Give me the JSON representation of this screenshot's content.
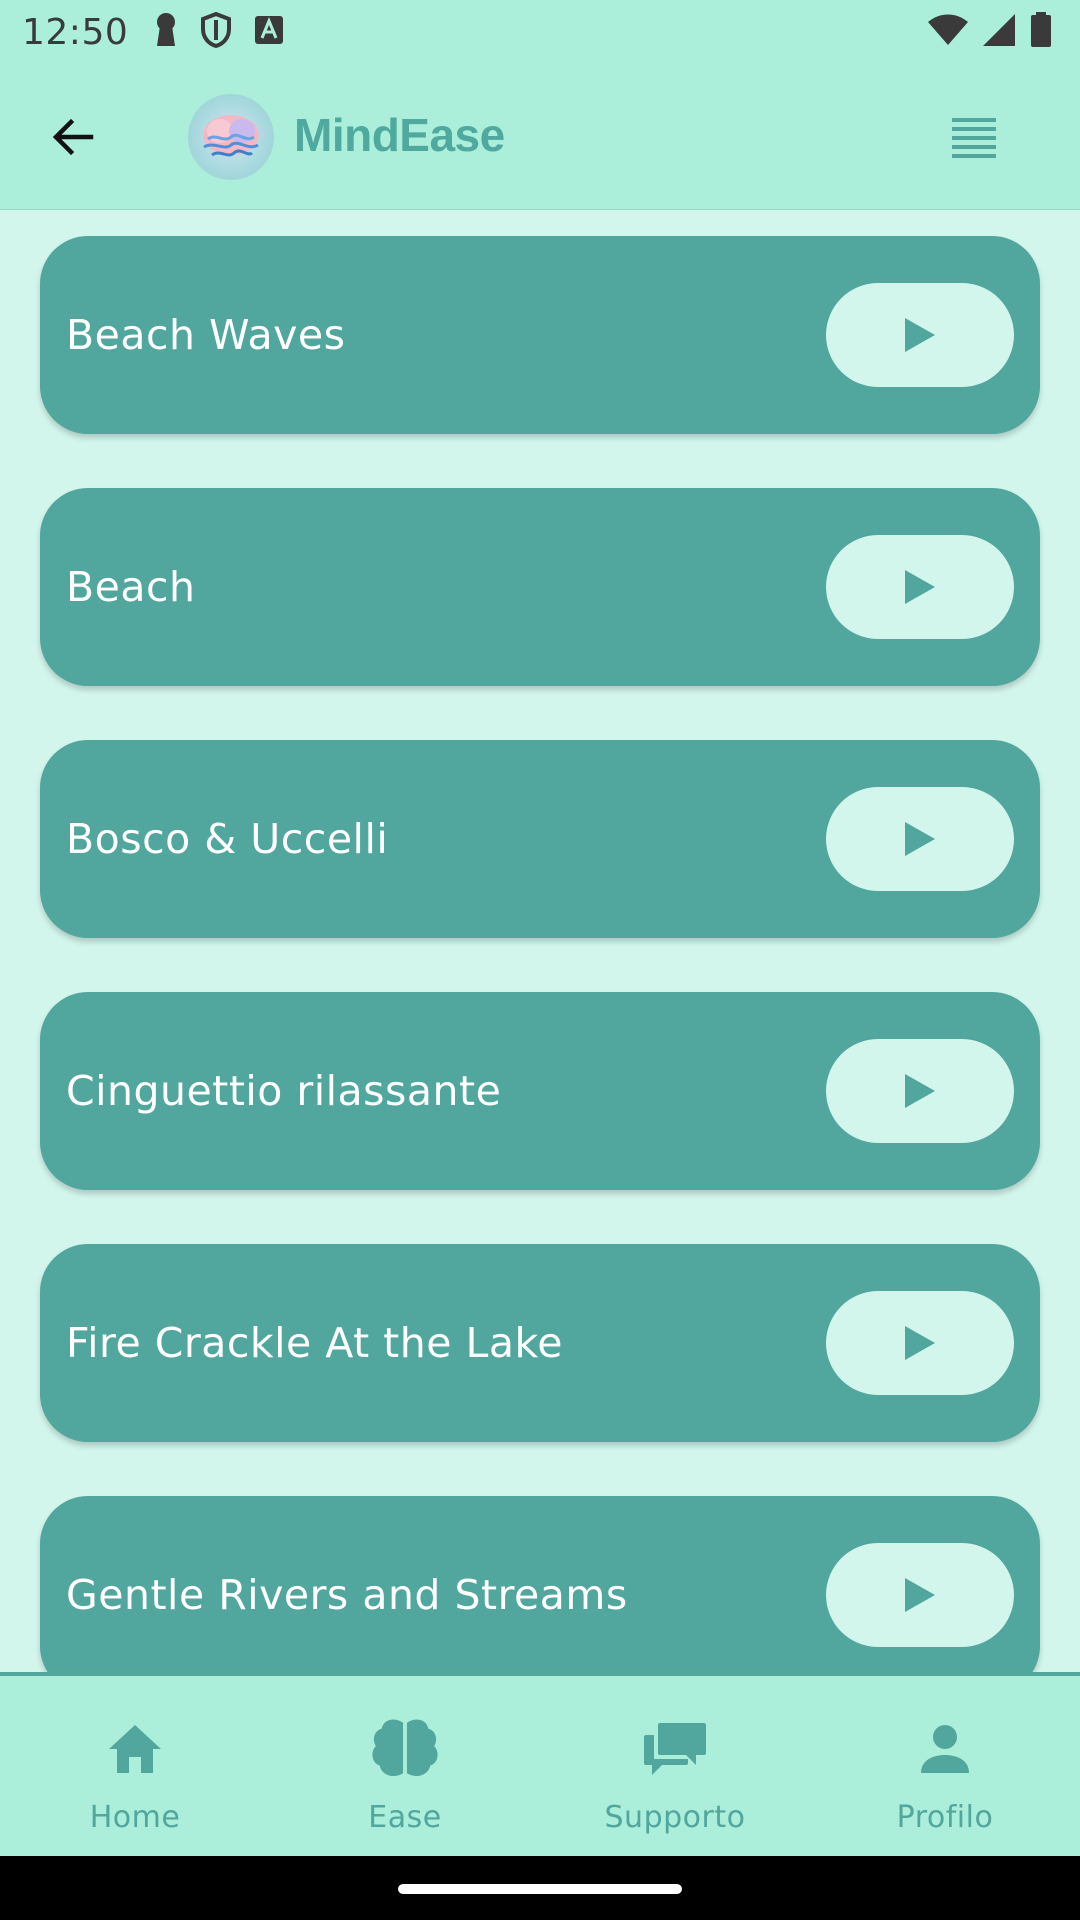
{
  "status_bar": {
    "time": "12:50",
    "left_icons": [
      "keyhole-icon",
      "shield-icon",
      "font-icon"
    ],
    "right_icons": [
      "wifi-icon",
      "signal-icon",
      "battery-icon"
    ]
  },
  "app_bar": {
    "title": "MindEase",
    "back_icon": "back-arrow-icon",
    "menu_icon": "menu-icon",
    "logo": "brain-logo"
  },
  "sounds": [
    {
      "name": "Beach Waves"
    },
    {
      "name": "Beach"
    },
    {
      "name": "Bosco & Uccelli"
    },
    {
      "name": "Cinguettio rilassante"
    },
    {
      "name": "Fire Crackle At the Lake"
    },
    {
      "name": "Gentle Rivers and Streams"
    }
  ],
  "bottom_nav": [
    {
      "label": "Home",
      "icon": "home-icon"
    },
    {
      "label": "Ease",
      "icon": "brain-icon"
    },
    {
      "label": "Supporto",
      "icon": "chat-icon"
    },
    {
      "label": "Profilo",
      "icon": "person-icon"
    }
  ],
  "colors": {
    "header_bg": "#abeed9",
    "page_bg": "#d3f6ec",
    "card": "#51a69d",
    "accent": "#4fa99f"
  }
}
